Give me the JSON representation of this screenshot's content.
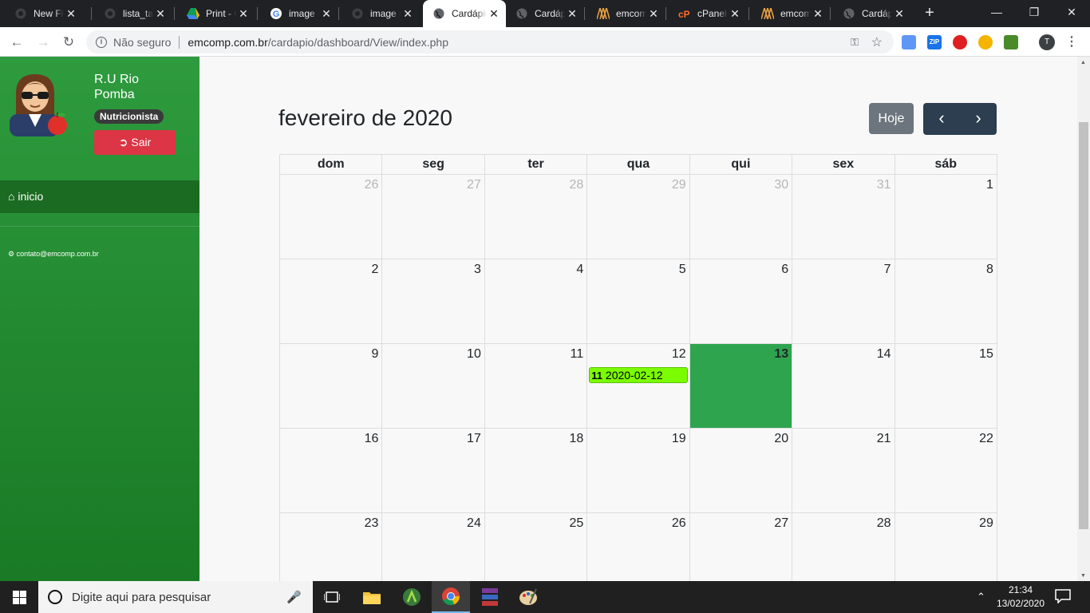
{
  "browser": {
    "tabs": [
      {
        "title": "New File",
        "favicon": "github-icon",
        "active": false
      },
      {
        "title": "lista_tarefas",
        "favicon": "github-icon",
        "active": false
      },
      {
        "title": "Print - Google Drive",
        "favicon": "google-drive-icon",
        "active": false
      },
      {
        "title": "image - Google",
        "favicon": "google-icon",
        "active": false
      },
      {
        "title": "image upload",
        "favicon": "github-icon",
        "active": false
      },
      {
        "title": "Cardápio",
        "favicon": "globe-icon",
        "active": true
      },
      {
        "title": "Cardápio",
        "favicon": "globe-icon",
        "active": false
      },
      {
        "title": "emcomp",
        "favicon": "emcomp-icon",
        "active": false
      },
      {
        "title": "cPanel",
        "favicon": "cpanel-icon",
        "active": false
      },
      {
        "title": "emcomp",
        "favicon": "emcomp-icon",
        "active": false
      },
      {
        "title": "Cardápio",
        "favicon": "globe-icon",
        "active": false
      }
    ],
    "new_tab": "+",
    "url_security": "Não seguro",
    "url_host": "emcomp.com.br",
    "url_path": "/cardapio/dashboard/View/index.php",
    "profile_initial": "T",
    "extensions": [
      {
        "name": "docs-extension-icon",
        "color": "#5e97f6",
        "text": ""
      },
      {
        "name": "zip-extension-icon",
        "color": "#1a73e8",
        "text": "ZIP"
      },
      {
        "name": "adblock-extension-icon",
        "color": "#e02020",
        "text": ""
      },
      {
        "name": "color-picker-extension-icon",
        "color": "#f4b400",
        "text": ""
      },
      {
        "name": "page-extension-icon",
        "color": "#4a8a2a",
        "text": ""
      }
    ]
  },
  "sidebar": {
    "user_name": "R.U Rio Pomba",
    "role": "Nutricionista",
    "logout_label": "Sair",
    "nav": [
      {
        "label": "inicio",
        "icon": "home-icon"
      }
    ],
    "contact": "contato@emcomp.com.br"
  },
  "calendar": {
    "title": "fevereiro de 2020",
    "today_label": "Hoje",
    "prev_icon": "chevron-left-icon",
    "next_icon": "chevron-right-icon",
    "weekdays": [
      "dom",
      "seg",
      "ter",
      "qua",
      "qui",
      "sex",
      "sáb"
    ],
    "weeks": [
      [
        {
          "d": "26",
          "other": true
        },
        {
          "d": "27",
          "other": true
        },
        {
          "d": "28",
          "other": true
        },
        {
          "d": "29",
          "other": true
        },
        {
          "d": "30",
          "other": true
        },
        {
          "d": "31",
          "other": true
        },
        {
          "d": "1"
        }
      ],
      [
        {
          "d": "2"
        },
        {
          "d": "3"
        },
        {
          "d": "4"
        },
        {
          "d": "5"
        },
        {
          "d": "6"
        },
        {
          "d": "7"
        },
        {
          "d": "8"
        }
      ],
      [
        {
          "d": "9"
        },
        {
          "d": "10"
        },
        {
          "d": "11"
        },
        {
          "d": "12",
          "event": {
            "time": "11",
            "title": "2020-02-12"
          }
        },
        {
          "d": "13",
          "today": true
        },
        {
          "d": "14"
        },
        {
          "d": "15"
        }
      ],
      [
        {
          "d": "16"
        },
        {
          "d": "17"
        },
        {
          "d": "18"
        },
        {
          "d": "19"
        },
        {
          "d": "20"
        },
        {
          "d": "21"
        },
        {
          "d": "22"
        }
      ],
      [
        {
          "d": "23"
        },
        {
          "d": "24"
        },
        {
          "d": "25"
        },
        {
          "d": "26"
        },
        {
          "d": "27"
        },
        {
          "d": "28"
        },
        {
          "d": "29"
        }
      ]
    ],
    "today_color": "#2ea44f",
    "event_color": "#7cfc00"
  },
  "taskbar": {
    "search_placeholder": "Digite aqui para pesquisar",
    "time": "21:34",
    "date": "13/02/2020"
  }
}
